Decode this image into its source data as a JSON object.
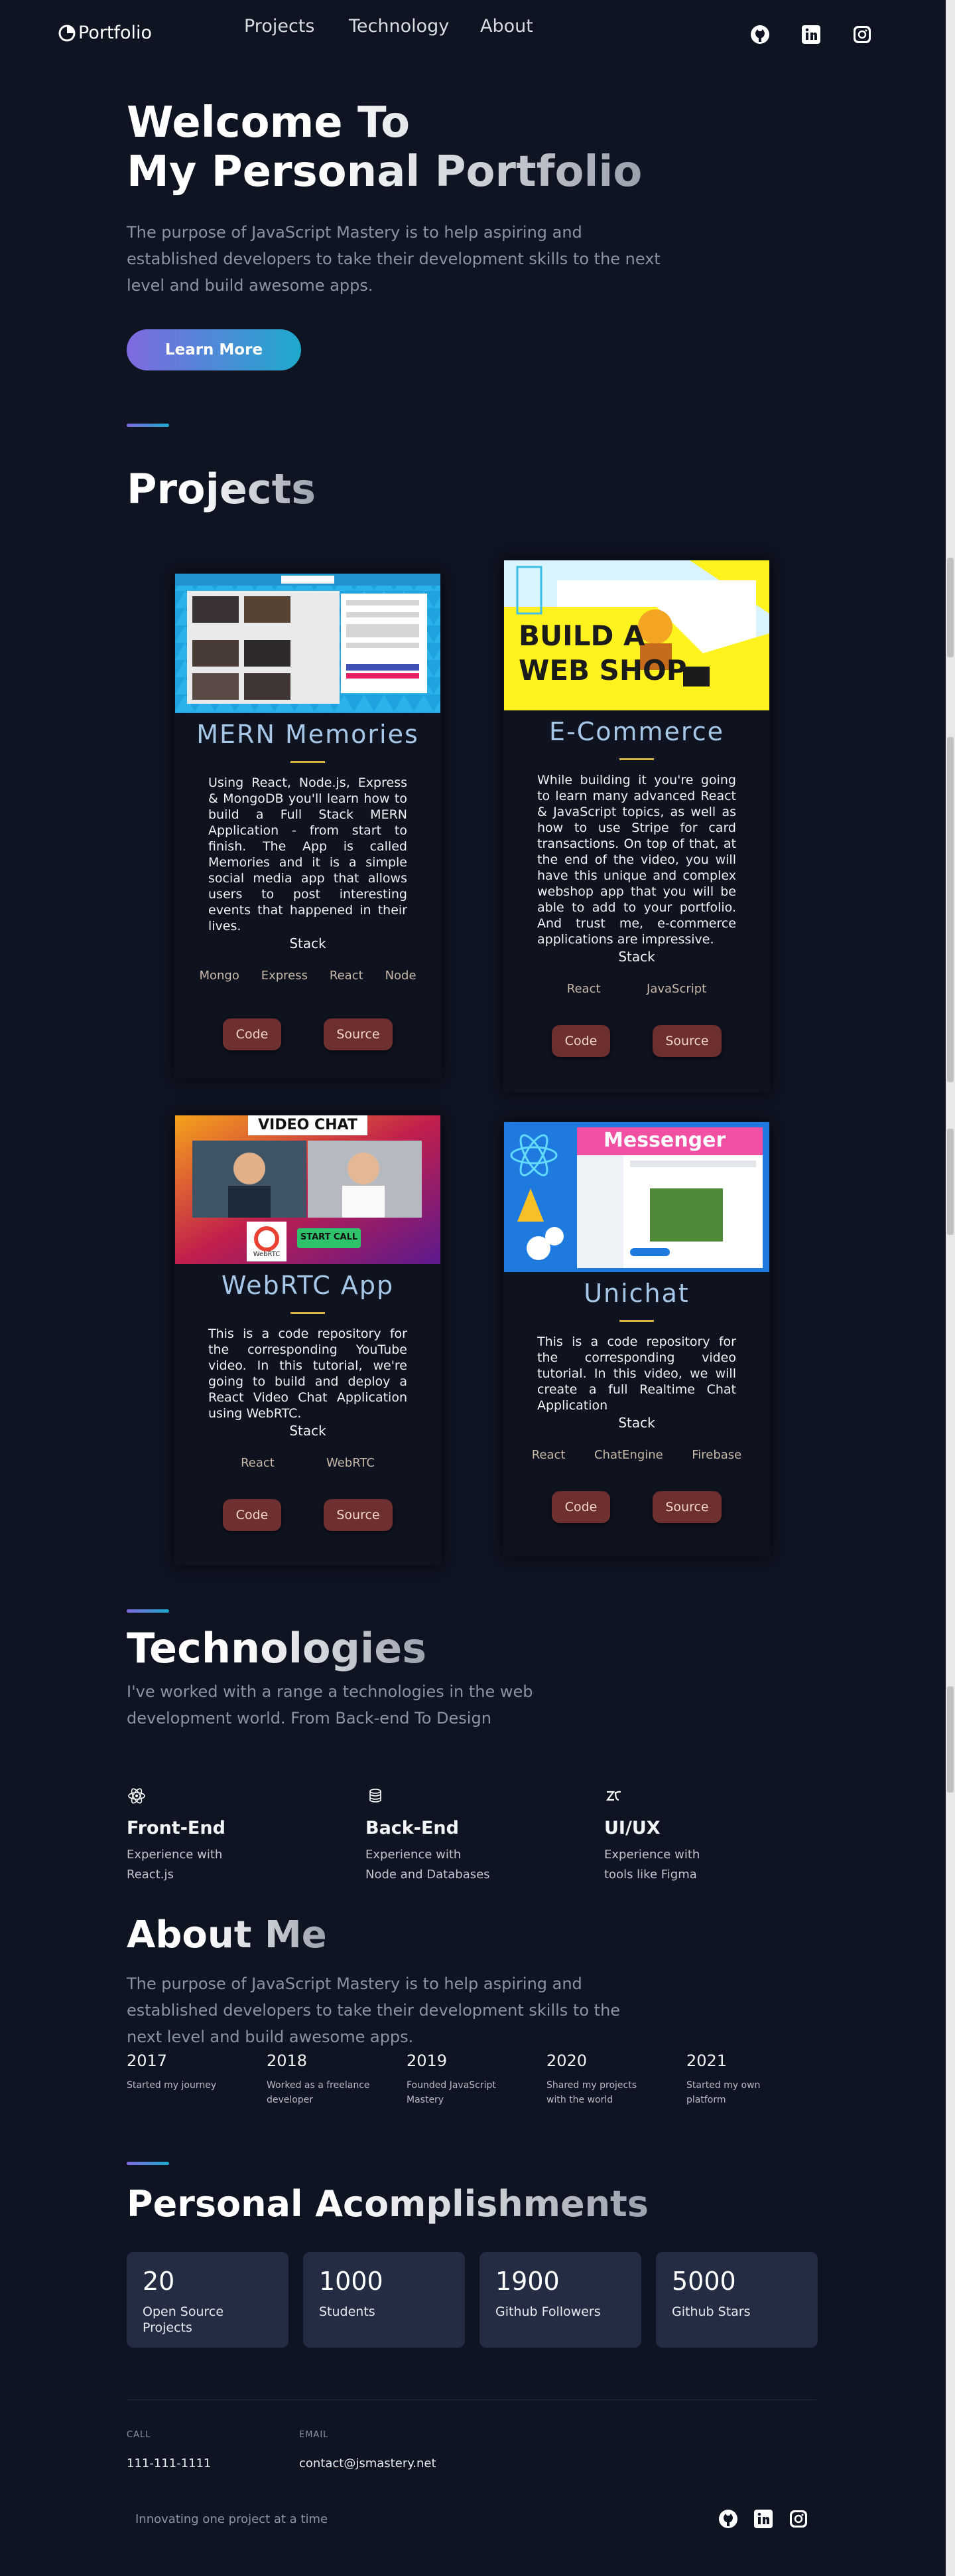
{
  "nav": {
    "logo_label": "Portfolio",
    "links": [
      "Projects",
      "Technology",
      "About"
    ],
    "social": [
      "github-icon",
      "linkedin-icon",
      "instagram-icon"
    ]
  },
  "hero": {
    "title_line1": "Welcome To",
    "title_line2": "My Personal Portfolio",
    "description": "The purpose of JavaScript Mastery is to help aspiring and established developers to take their development skills to the next level and build awesome apps.",
    "button": "Learn More"
  },
  "projects": {
    "heading": "Projects",
    "stack_label": "Stack",
    "code_label": "Code",
    "source_label": "Source",
    "items": [
      {
        "title": "MERN Memories",
        "description": "Using React, Node.js, Express & MongoDB you'll learn how to build a Full Stack MERN Application - from start to finish. The App is called Memories and it is a simple social media app that allows users to post interesting events that happened in their lives.",
        "tags": [
          "Mongo",
          "Express",
          "React",
          "Node"
        ]
      },
      {
        "title": "E-Commerce",
        "description": "While building it you're going to learn many advanced React & JavaScript topics, as well as how to use Stripe for card transactions. On top of that, at the end of the video, you will have this unique and complex webshop app that you will be able to add to your portfolio. And trust me, e-commerce applications are impressive.",
        "tags": [
          "React",
          "JavaScript"
        ],
        "image_text_line1": "BUILD A",
        "image_text_line2": "WEB SHOP"
      },
      {
        "title": "WebRTC App",
        "description": "This is a code repository for the corresponding YouTube video. In this tutorial, we're going to build and deploy a React Video Chat Application using WebRTC.",
        "tags": [
          "React",
          "WebRTC"
        ],
        "image_text_top": "VIDEO CHAT",
        "image_text_button": "START CALL",
        "image_text_logo": "WebRTC"
      },
      {
        "title": "Unichat",
        "description": "This is a code repository for the corresponding video tutorial. In this video, we will create a full Realtime Chat Application",
        "tags": [
          "React",
          "ChatEngine",
          "Firebase"
        ],
        "image_text_banner": "Messenger"
      }
    ]
  },
  "technologies": {
    "heading": "Technologies",
    "description": "I've worked with a range a technologies in the web development world. From Back-end To Design",
    "items": [
      {
        "icon": "react-atom-icon",
        "title": "Front-End",
        "line1": "Experience with",
        "line2": "React.js"
      },
      {
        "icon": "database-icon",
        "title": "Back-End",
        "line1": "Experience with",
        "line2": "Node and Databases"
      },
      {
        "icon": "zeplin-icon",
        "title": "UI/UX",
        "line1": "Experience with",
        "line2": "tools like Figma"
      }
    ]
  },
  "about": {
    "heading": "About Me",
    "description": "The purpose of JavaScript Mastery is to help aspiring and established developers to take their development skills to the next level and build awesome apps.",
    "timeline": [
      {
        "year": "2017",
        "text": "Started my journey"
      },
      {
        "year": "2018",
        "text": "Worked as a freelance developer"
      },
      {
        "year": "2019",
        "text": "Founded JavaScript Mastery"
      },
      {
        "year": "2020",
        "text": "Shared my projects with the world"
      },
      {
        "year": "2021",
        "text": "Started my own platform"
      }
    ]
  },
  "accomplishments": {
    "heading": "Personal Acomplishments",
    "items": [
      {
        "number": "20",
        "label": "Open Source Projects"
      },
      {
        "number": "1000",
        "label": "Students"
      },
      {
        "number": "1900",
        "label": "Github Followers"
      },
      {
        "number": "5000",
        "label": "Github Stars"
      }
    ]
  },
  "footer": {
    "call_label": "CALL",
    "call_value": "111-111-1111",
    "email_label": "EMAIL",
    "email_value": "contact@jsmastery.net",
    "slogan": "Innovating one project at a time"
  },
  "colors": {
    "background": "#0f1422",
    "accent_gradient_start": "#7f6ae0",
    "accent_gradient_end": "#1ea9cc",
    "card_button": "#6d2f2f",
    "stat_card": "#232c42"
  }
}
